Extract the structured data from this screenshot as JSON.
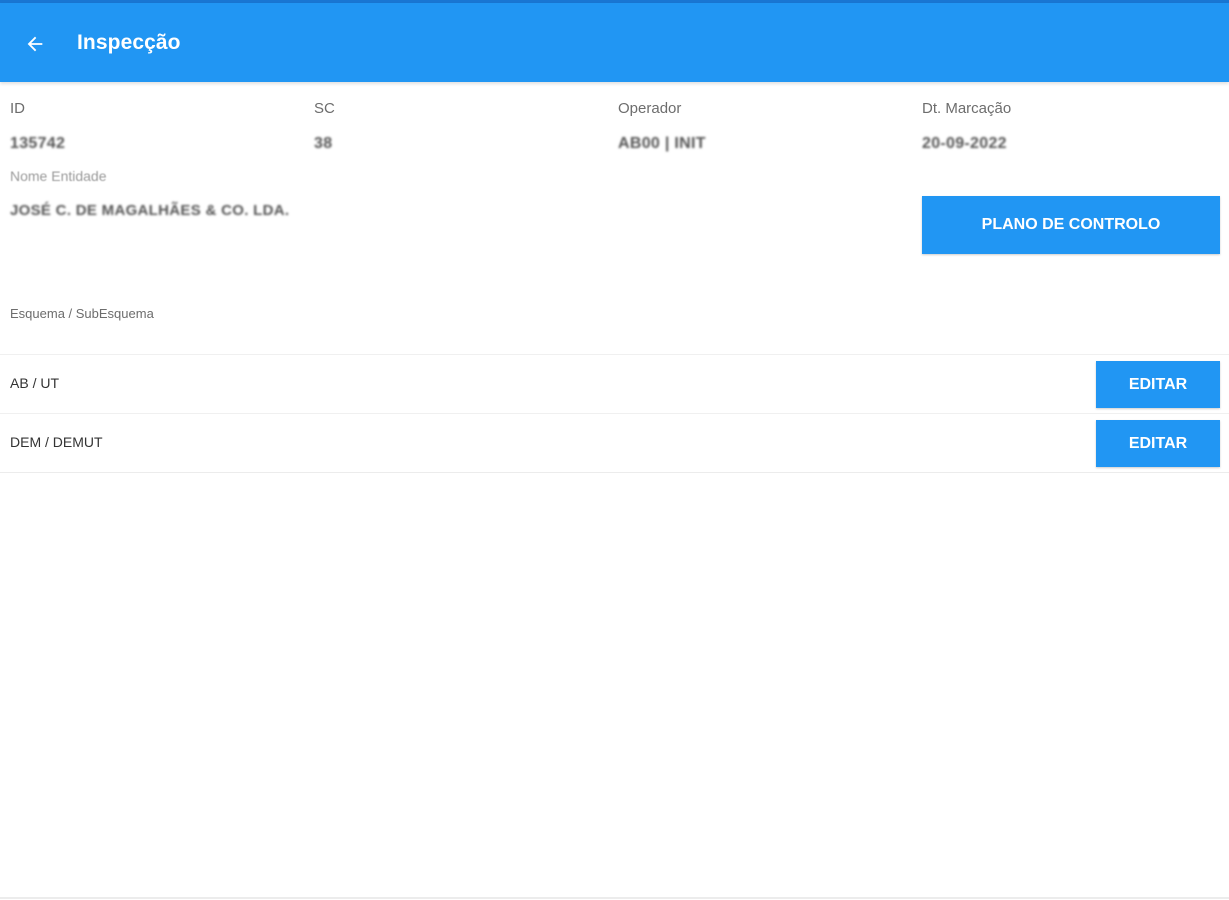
{
  "appbar": {
    "title": "Inspecção",
    "back_icon": "arrow-back-icon",
    "color": "#2196f3"
  },
  "fields": [
    {
      "label": "ID",
      "value": "135742"
    },
    {
      "label": "SC",
      "value": "38"
    },
    {
      "label": "Operador",
      "value": "AB00 | INIT"
    },
    {
      "label": "Dt. Marcação",
      "value": "20-09-2022"
    }
  ],
  "entity": {
    "label": "Nome Entidade",
    "value": "JOSÉ C. DE MAGALHÃES & CO. LDA."
  },
  "plano_button": {
    "label": "PLANO DE CONTROLO"
  },
  "schemes": {
    "header": "Esquema / SubEsquema",
    "rows": [
      {
        "label": "AB / UT",
        "button": "EDITAR"
      },
      {
        "label": "DEM / DEMUT",
        "button": "EDITAR"
      }
    ]
  }
}
